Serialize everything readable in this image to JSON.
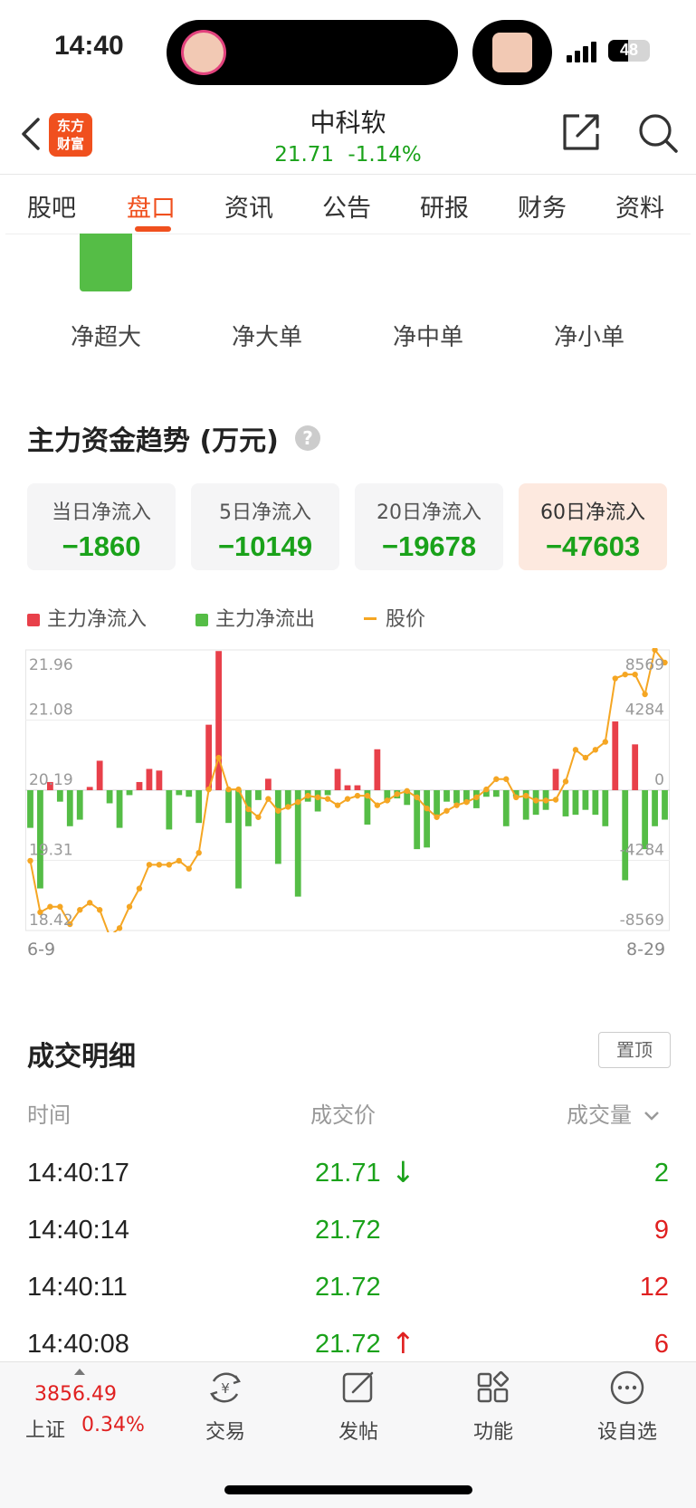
{
  "status": {
    "time": "14:40",
    "battery": "48"
  },
  "header": {
    "logo_line1": "东方",
    "logo_line2": "财富",
    "stock_name": "中科软",
    "price": "21.71",
    "change": "-1.14%"
  },
  "tabs": [
    {
      "label": "股吧"
    },
    {
      "label": "盘口"
    },
    {
      "label": "资讯"
    },
    {
      "label": "公告"
    },
    {
      "label": "研报"
    },
    {
      "label": "财务"
    },
    {
      "label": "资料"
    }
  ],
  "flow_labels": [
    "净超大",
    "净大单",
    "净中单",
    "净小单"
  ],
  "trend": {
    "title": "主力资金趋势 (万元)",
    "cards": [
      {
        "label": "当日净流入",
        "value": "−1860"
      },
      {
        "label": "5日净流入",
        "value": "−10149"
      },
      {
        "label": "20日净流入",
        "value": "−19678"
      },
      {
        "label": "60日净流入",
        "value": "−47603"
      }
    ],
    "legend": {
      "inflow": "主力净流入",
      "outflow": "主力净流出",
      "price": "股价"
    },
    "date_start": "6-9",
    "date_end": "8-29",
    "colors": {
      "inflow": "#e8404a",
      "outflow": "#55bd46",
      "price": "#f5a623"
    }
  },
  "chart_data": {
    "type": "bar",
    "x_start": "6-9",
    "x_end": "8-29",
    "left_ticks": [
      "21.96",
      "21.08",
      "20.19",
      "19.31",
      "18.42"
    ],
    "right_ticks": [
      "8569",
      "4284",
      "0",
      "-4284",
      "-8569"
    ],
    "left_range": [
      18.42,
      21.96
    ],
    "right_range": [
      -8569,
      8569
    ],
    "series": [
      {
        "name": "主力净流入/流出",
        "values": [
          -2300,
          -6000,
          500,
          -700,
          -2200,
          -1800,
          200,
          1800,
          -800,
          -2300,
          -300,
          500,
          1300,
          1200,
          -2400,
          -300,
          -400,
          -2000,
          4000,
          8500,
          -2000,
          -6000,
          -2200,
          -600,
          700,
          -4500,
          -1100,
          -6500,
          -700,
          -1300,
          -300,
          1300,
          300,
          300,
          -2100,
          2500,
          -700,
          -500,
          -900,
          -3600,
          -3500,
          -1500,
          -700,
          -800,
          -800,
          -1100,
          -400,
          -400,
          -2200,
          -400,
          -1800,
          -1500,
          -1200,
          1300,
          -1600,
          -1500,
          -1200,
          -1500,
          -2200,
          4200,
          -5500,
          2800,
          -3600,
          -2200,
          -1800
        ]
      },
      {
        "name": "股价",
        "values": [
          19.3,
          18.65,
          18.72,
          18.72,
          18.5,
          18.68,
          18.77,
          18.68,
          18.35,
          18.45,
          18.72,
          18.95,
          19.25,
          19.25,
          19.25,
          19.3,
          19.2,
          19.4,
          20.2,
          20.6,
          20.2,
          20.2,
          19.95,
          19.85,
          20.08,
          19.93,
          19.98,
          20.04,
          20.12,
          20.1,
          20.08,
          20.0,
          20.08,
          20.12,
          20.12,
          20.0,
          20.06,
          20.14,
          20.18,
          20.1,
          19.96,
          19.85,
          19.93,
          20.0,
          20.04,
          20.1,
          20.2,
          20.33,
          20.33,
          20.1,
          20.12,
          20.06,
          20.06,
          20.07,
          20.3,
          20.7,
          20.6,
          20.7,
          20.8,
          21.6,
          21.65,
          21.65,
          21.4,
          21.96,
          21.8
        ]
      }
    ]
  },
  "trade_detail": {
    "title": "成交明细",
    "pin_label": "置顶",
    "headers": {
      "time": "时间",
      "price": "成交价",
      "volume": "成交量"
    },
    "rows": [
      {
        "time": "14:40:17",
        "price": "21.71",
        "arrow": "↓",
        "volume": "2"
      },
      {
        "time": "14:40:14",
        "price": "21.72",
        "arrow": "",
        "volume": "9"
      },
      {
        "time": "14:40:11",
        "price": "21.72",
        "arrow": "",
        "volume": "12"
      },
      {
        "time": "14:40:08",
        "price": "21.72",
        "arrow": "↑",
        "volume": "6"
      }
    ]
  },
  "bottom": {
    "index_value": "3856.49",
    "index_name": "上证",
    "index_change": "0.34%",
    "nav": [
      {
        "label": "交易"
      },
      {
        "label": "发帖"
      },
      {
        "label": "功能"
      },
      {
        "label": "设自选"
      }
    ]
  }
}
